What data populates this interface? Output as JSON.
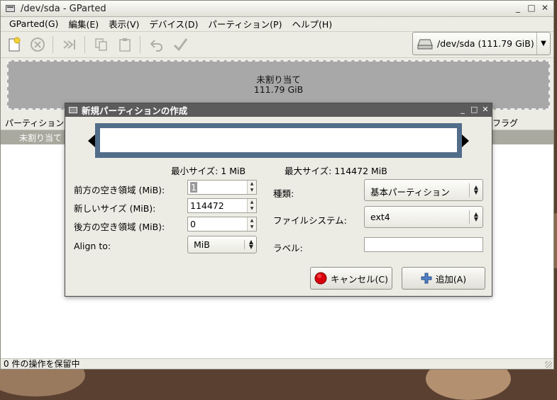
{
  "window": {
    "title": "/dev/sda - GParted",
    "controls": [
      "_",
      "□",
      "✕"
    ]
  },
  "menu": [
    "GParted(G)",
    "編集(E)",
    "表示(V)",
    "デバイス(D)",
    "パーティション(P)",
    "ヘルプ(H)"
  ],
  "toolbar": {
    "icons": [
      "new-icon",
      "delete-icon",
      "resize-icon",
      "copy-icon",
      "paste-icon",
      "undo-icon",
      "apply-icon"
    ],
    "device": "/dev/sda  (111.79 GiB)"
  },
  "disk_map": {
    "label": "未割り当て",
    "size": "111.79 GiB"
  },
  "partition_list": {
    "col_partition": "パーティション",
    "col_flags": "フラグ",
    "rows": [
      {
        "partition": "未割り当て"
      }
    ]
  },
  "status": "0 件の操作を保留中",
  "dialog": {
    "title": "新規パーティションの作成",
    "controls": [
      "_",
      "□",
      "✕"
    ],
    "min_size": "最小サイズ: 1 MiB",
    "max_size": "最大サイズ: 114472 MiB",
    "fields": {
      "free_before_label": "前方の空き領域 (MiB):",
      "free_before_value": "1",
      "new_size_label": "新しいサイズ (MiB):",
      "new_size_value": "114472",
      "free_after_label": "後方の空き領域 (MiB):",
      "free_after_value": "0",
      "align_label": "Align to:",
      "align_value": "MiB",
      "type_label": "種類:",
      "type_value": "基本パーティション",
      "fs_label": "ファイルシステム:",
      "fs_value": "ext4",
      "label_label": "ラベル:",
      "label_value": ""
    },
    "cancel_label": "キャンセル(C)",
    "add_label": "追加(A)"
  }
}
